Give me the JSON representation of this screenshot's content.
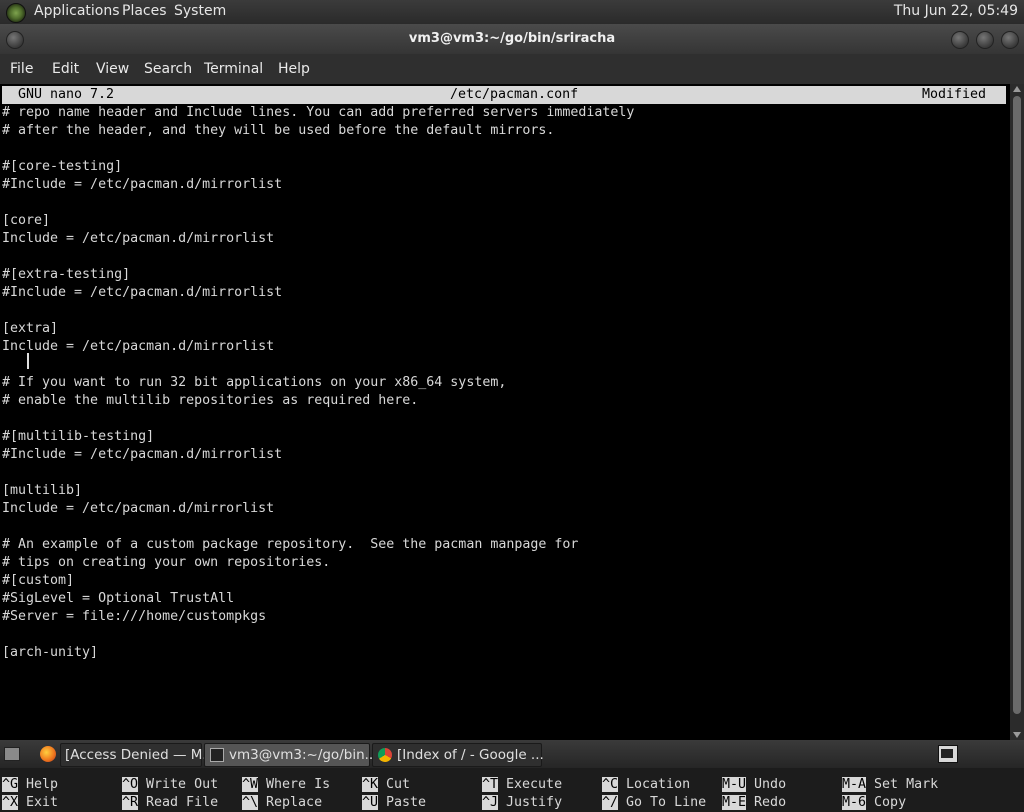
{
  "top_panel": {
    "menus": [
      "Applications",
      "Places",
      "System"
    ],
    "clock": "Thu Jun 22, 05:49"
  },
  "window": {
    "title": "vm3@vm3:~/go/bin/sriracha",
    "menu": [
      "File",
      "Edit",
      "View",
      "Search",
      "Terminal",
      "Help"
    ]
  },
  "nano": {
    "version": "GNU nano 7.2",
    "filename": "/etc/pacman.conf",
    "status": "Modified",
    "lines": [
      "# repo name header and Include lines. You can add preferred servers immediately",
      "# after the header, and they will be used before the default mirrors.",
      "",
      "#[core-testing]",
      "#Include = /etc/pacman.d/mirrorlist",
      "",
      "[core]",
      "Include = /etc/pacman.d/mirrorlist",
      "",
      "#[extra-testing]",
      "#Include = /etc/pacman.d/mirrorlist",
      "",
      "[extra]",
      "Include = /etc/pacman.d/mirrorlist",
      "",
      "# If you want to run 32 bit applications on your x86_64 system,",
      "# enable the multilib repositories as required here.",
      "",
      "#[multilib-testing]",
      "#Include = /etc/pacman.d/mirrorlist",
      "",
      "[multilib]",
      "Include = /etc/pacman.d/mirrorlist",
      "",
      "# An example of a custom package repository.  See the pacman manpage for",
      "# tips on creating your own repositories.",
      "#[custom]",
      "#SigLevel = Optional TrustAll",
      "#Server = file:///home/custompkgs",
      "",
      "[arch-unity]"
    ],
    "shortcuts": [
      {
        "key": "^G",
        "label": "Help"
      },
      {
        "key": "^O",
        "label": "Write Out"
      },
      {
        "key": "^W",
        "label": "Where Is"
      },
      {
        "key": "^K",
        "label": "Cut"
      },
      {
        "key": "^T",
        "label": "Execute"
      },
      {
        "key": "^C",
        "label": "Location"
      },
      {
        "key": "M-U",
        "label": "Undo"
      },
      {
        "key": "M-A",
        "label": "Set Mark"
      },
      {
        "key": "^X",
        "label": "Exit"
      },
      {
        "key": "^R",
        "label": "Read File"
      },
      {
        "key": "^\\",
        "label": "Replace"
      },
      {
        "key": "^U",
        "label": "Paste"
      },
      {
        "key": "^J",
        "label": "Justify"
      },
      {
        "key": "^/",
        "label": "Go To Line"
      },
      {
        "key": "M-E",
        "label": "Redo"
      },
      {
        "key": "M-6",
        "label": "Copy"
      }
    ]
  },
  "taskbar": {
    "tasks": [
      {
        "title": "[Access Denied — M...",
        "icon": "firefox-icon"
      },
      {
        "title": "vm3@vm3:~/go/bin...",
        "icon": "terminal-icon"
      },
      {
        "title": "[Index of / - Google ...",
        "icon": "chrome-icon"
      }
    ]
  }
}
